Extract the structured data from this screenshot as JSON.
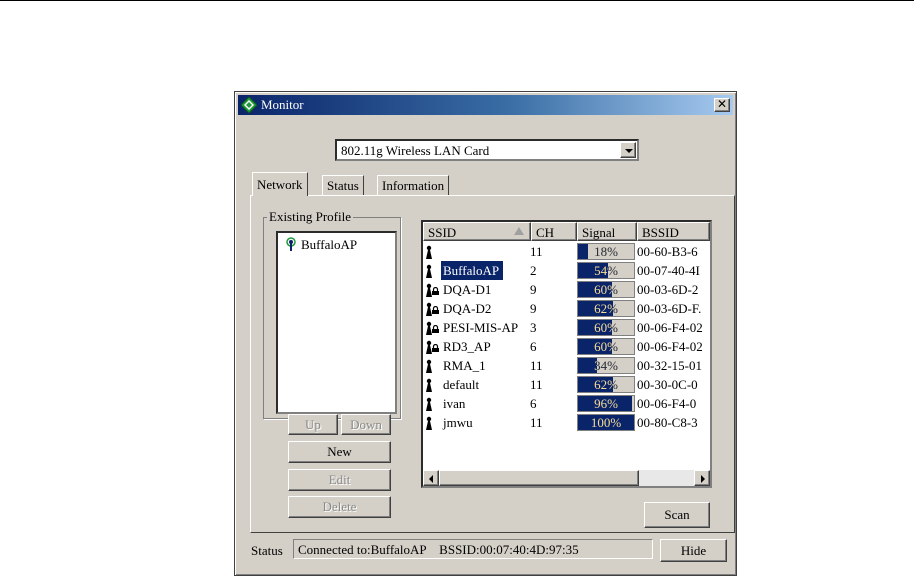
{
  "window": {
    "title": "Monitor",
    "close_glyph": "✕"
  },
  "adapter": {
    "selected": "802.11g Wireless LAN Card"
  },
  "tabs": [
    {
      "label": "Network",
      "active": true
    },
    {
      "label": "Status",
      "active": false
    },
    {
      "label": "Information",
      "active": false
    }
  ],
  "profiles": {
    "group_label": "Existing Profile",
    "items": [
      {
        "name": "BuffaloAP"
      }
    ],
    "buttons": {
      "up": "Up",
      "down": "Down",
      "new": "New",
      "edit": "Edit",
      "delete": "Delete"
    }
  },
  "networks": {
    "columns": {
      "ssid": "SSID",
      "ch": "CH",
      "signal": "Signal",
      "bssid": "BSSID"
    },
    "rows": [
      {
        "ssid": "",
        "ch": "11",
        "signal": "18%",
        "signal_pct": 18,
        "bssid": "00-60-B3-6",
        "lock": false,
        "selected": false
      },
      {
        "ssid": "BuffaloAP",
        "ch": "2",
        "signal": "54%",
        "signal_pct": 54,
        "bssid": "00-07-40-4I",
        "lock": false,
        "selected": true
      },
      {
        "ssid": "DQA-D1",
        "ch": "9",
        "signal": "60%",
        "signal_pct": 60,
        "bssid": "00-03-6D-2",
        "lock": true,
        "selected": false
      },
      {
        "ssid": "DQA-D2",
        "ch": "9",
        "signal": "62%",
        "signal_pct": 62,
        "bssid": "00-03-6D-F.",
        "lock": true,
        "selected": false
      },
      {
        "ssid": "PESI-MIS-AP",
        "ch": "3",
        "signal": "60%",
        "signal_pct": 60,
        "bssid": "00-06-F4-02",
        "lock": true,
        "selected": false
      },
      {
        "ssid": "RD3_AP",
        "ch": "6",
        "signal": "60%",
        "signal_pct": 60,
        "bssid": "00-06-F4-02",
        "lock": true,
        "selected": false
      },
      {
        "ssid": "RMA_1",
        "ch": "11",
        "signal": "34%",
        "signal_pct": 34,
        "bssid": "00-32-15-01",
        "lock": false,
        "selected": false
      },
      {
        "ssid": "default",
        "ch": "11",
        "signal": "62%",
        "signal_pct": 62,
        "bssid": "00-30-0C-0",
        "lock": false,
        "selected": false
      },
      {
        "ssid": "ivan",
        "ch": "6",
        "signal": "96%",
        "signal_pct": 96,
        "bssid": "00-06-F4-0",
        "lock": false,
        "selected": false
      },
      {
        "ssid": "jmwu",
        "ch": "11",
        "signal": "100%",
        "signal_pct": 100,
        "bssid": "00-80-C8-3",
        "lock": false,
        "selected": false
      }
    ]
  },
  "scan_label": "Scan",
  "status": {
    "label": "Status",
    "text": "Connected to:BuffaloAP    BSSID:00:07:40:4D:97:35"
  },
  "hide_label": "Hide",
  "colors": {
    "accent": "#0a246a",
    "face": "#d4d0c8"
  }
}
